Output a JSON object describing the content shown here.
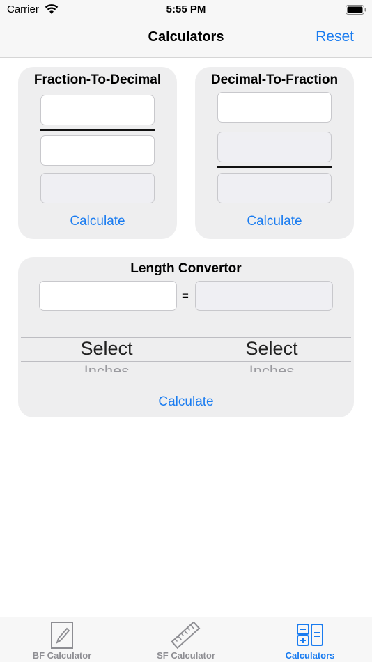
{
  "status_bar": {
    "carrier": "Carrier",
    "time": "5:55 PM"
  },
  "nav": {
    "title": "Calculators",
    "reset_label": "Reset"
  },
  "fraction_to_decimal": {
    "title": "Fraction-To-Decimal",
    "numerator_value": "",
    "denominator_value": "",
    "result_value": "",
    "calculate_label": "Calculate"
  },
  "decimal_to_fraction": {
    "title": "Decimal-To-Fraction",
    "decimal_value": "",
    "numerator_value": "",
    "denominator_value": "",
    "calculate_label": "Calculate"
  },
  "length_convertor": {
    "title": "Length Convertor",
    "input_value": "",
    "equals": "=",
    "output_value": "",
    "from_picker": {
      "selected": "Select",
      "next": "Inches"
    },
    "to_picker": {
      "selected": "Select",
      "next": "Inches"
    },
    "calculate_label": "Calculate"
  },
  "tabs": [
    {
      "label": "BF Calculator",
      "icon": "pencil-square-icon",
      "active": false
    },
    {
      "label": "SF Calculator",
      "icon": "ruler-icon",
      "active": false
    },
    {
      "label": "Calculators",
      "icon": "calculator-icon",
      "active": true
    }
  ],
  "colors": {
    "accent": "#1a7cf0",
    "card_bg": "#eeeeef",
    "inactive_tab": "#8e8e93"
  }
}
